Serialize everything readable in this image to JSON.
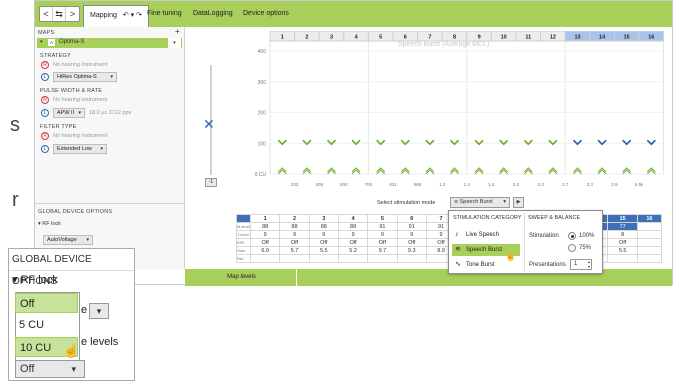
{
  "outside_text": {
    "s": "s",
    "r": "r"
  },
  "toolbar": {
    "nav_buttons": [
      "<",
      "⇆",
      ">"
    ],
    "tabs": [
      {
        "label": "Mapping",
        "active": true,
        "suffix": "↶ ▾ ↷"
      },
      {
        "label": "Fine tuning"
      },
      {
        "label": "DataLogging"
      },
      {
        "label": "Device options"
      }
    ]
  },
  "left_panel": {
    "maps_label": "MAPS",
    "plus": "+",
    "map_name": "Optima-S",
    "strategy": {
      "label": "STRATEGY",
      "warning": "No hearing instrument",
      "value": "HiRes Optima-S"
    },
    "pulse": {
      "label": "PULSE WIDTH & RATE",
      "warning": "No hearing instrument",
      "value": "APW II",
      "extra": "18.0 µs  3712 pps"
    },
    "filter": {
      "label": "FILTER TYPE",
      "warning": "No hearing instrument",
      "value": "Extended Low"
    },
    "global": {
      "label": "GLOBAL DEVICE OPTIONS",
      "rf_lock": "RF lock",
      "rf_value": "AutoVoltage"
    },
    "icons": {
      "r": "R",
      "l": "L"
    }
  },
  "chart": {
    "title": "Speech Burst (Average MCL)",
    "channels": [
      "1",
      "2",
      "3",
      "4",
      "5",
      "6",
      "7",
      "8",
      "9",
      "10",
      "11",
      "12",
      "13",
      "14",
      "15",
      "16"
    ],
    "y_ticks": [
      "400",
      "300",
      "200",
      "100",
      "0 CU"
    ],
    "x_ticks": [
      "333",
      "408",
      "500",
      "700",
      "831",
      "986",
      "1.2",
      "1.4",
      "1.6",
      "2.0",
      "2.3",
      "2.7",
      "3.3",
      "3.9",
      "6.5k"
    ],
    "m_values": [
      100,
      100,
      100,
      100,
      100,
      100,
      100,
      100,
      100,
      100,
      100,
      100,
      100,
      100,
      100,
      100
    ],
    "t_values": [
      10,
      10,
      10,
      10,
      10,
      10,
      10,
      10,
      10,
      10,
      10,
      10,
      10,
      10,
      10,
      10
    ],
    "colors": {
      "green": "#6cab2e",
      "blue": "#2f5ea8"
    },
    "slider_button": "-1"
  },
  "stim": {
    "label": "Select stimulation mode",
    "value": "Speech Burst",
    "play": "▶"
  },
  "table": {
    "header": [
      "1",
      "2",
      "3",
      "4",
      "5",
      "6",
      "7",
      "8",
      "9",
      "10",
      "11",
      "12",
      "13",
      "14",
      "15",
      "16"
    ],
    "rows": [
      {
        "label": "M-level",
        "cells": [
          "88",
          "88",
          "88",
          "88",
          "91",
          "91",
          "91",
          "",
          "",
          "",
          "",
          "",
          "",
          "77",
          "77",
          ""
        ]
      },
      {
        "label": "T-level",
        "cells": [
          "9",
          "9",
          "9",
          "9",
          "9",
          "9",
          "9",
          "",
          "",
          "",
          "",
          "",
          "",
          "8",
          "8",
          ""
        ]
      },
      {
        "label": "IDR",
        "cells": [
          "Off",
          "Off",
          "Off",
          "Off",
          "Off",
          "Off",
          "Off",
          "",
          "",
          "",
          "",
          "",
          "",
          "Off",
          "Off",
          ""
        ]
      },
      {
        "label": "Gain",
        "cells": [
          "6.0",
          "5.7",
          "5.5",
          "5.2",
          "9.7",
          "9.3",
          "8.9",
          "",
          "",
          "",
          "",
          "",
          "",
          "7.8",
          "5.5",
          ""
        ]
      },
      {
        "label": "Ref",
        "cells": [
          "",
          "",
          "",
          "",
          "",
          "",
          "",
          "",
          "",
          "",
          "",
          "",
          "",
          "",
          "",
          ""
        ]
      }
    ]
  },
  "popup": {
    "cat_header": "STIMULATION CATEGORY",
    "sweep_header": "SWEEP & BALANCE",
    "items": [
      "Live Speech",
      "Speech Burst",
      "Tone Burst"
    ],
    "selected": 1,
    "stimulation_label": "Stimulation",
    "opt_100": "100%",
    "opt_75": "75%",
    "presentations_label": "Presentations",
    "presentations_value": "1"
  },
  "bottom": {
    "map_levels": "Map levels"
  },
  "zoom": {
    "header": "GLOBAL DEVICE OPTIONS",
    "rf_lock": "RF lock",
    "options": [
      "Off",
      "5 CU",
      "10 CU"
    ],
    "selected": 2,
    "partial_e": "e",
    "partial_levels": "e levels",
    "bottom_value": "Off"
  }
}
